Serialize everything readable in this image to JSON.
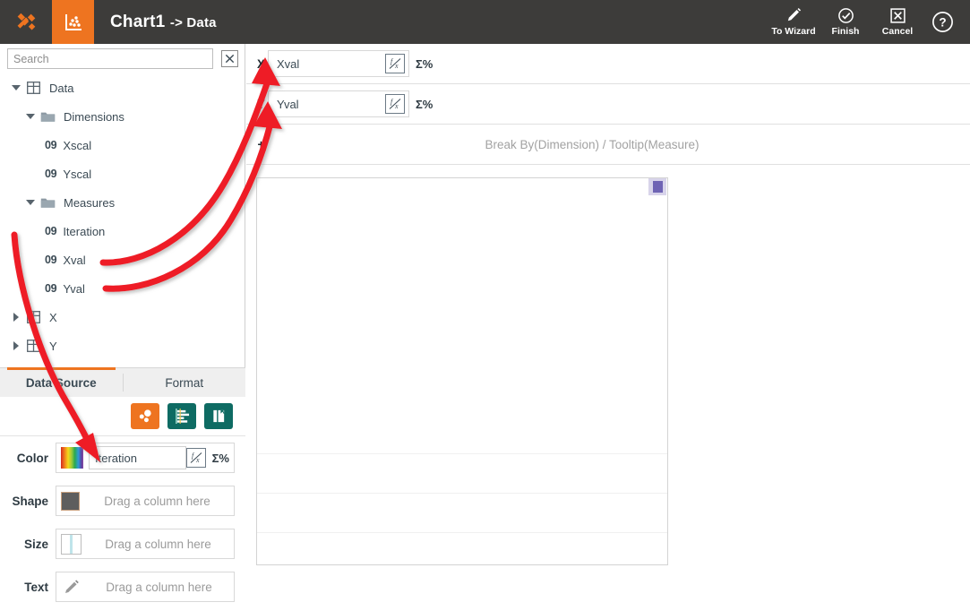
{
  "header": {
    "logo_icon": "crossed-tools-logo",
    "chart_type_icon": "scatter-plot-icon",
    "title": "Chart1",
    "title_suffix": "-> Data",
    "actions": [
      {
        "label": "To Wizard",
        "icon": "pencil-icon"
      },
      {
        "label": "Finish",
        "icon": "check-circle-icon"
      },
      {
        "label": "Cancel",
        "icon": "x-box-icon"
      }
    ],
    "help_icon": "question-circle-icon",
    "bg_color": "#3d3c3a",
    "accent_color": "#ee7420"
  },
  "left_panel": {
    "search": {
      "placeholder": "Search",
      "value": "",
      "clear_icon": "x-box-icon"
    },
    "tree": [
      {
        "label": "Data",
        "indent": 0,
        "caret": "down",
        "icon": "table-icon",
        "badge": ""
      },
      {
        "label": "Dimensions",
        "indent": 1,
        "caret": "down",
        "icon": "folder-icon",
        "badge": ""
      },
      {
        "label": "Xscal",
        "indent": 2,
        "caret": "none",
        "icon": "number-icon",
        "badge": "09"
      },
      {
        "label": "Yscal",
        "indent": 2,
        "caret": "none",
        "icon": "number-icon",
        "badge": "09"
      },
      {
        "label": "Measures",
        "indent": 1,
        "caret": "down",
        "icon": "folder-icon",
        "badge": ""
      },
      {
        "label": "Iteration",
        "indent": 2,
        "caret": "none",
        "icon": "number-icon",
        "badge": "09"
      },
      {
        "label": "Xval",
        "indent": 2,
        "caret": "none",
        "icon": "number-icon",
        "badge": "09"
      },
      {
        "label": "Yval",
        "indent": 2,
        "caret": "none",
        "icon": "number-icon",
        "badge": "09"
      },
      {
        "label": "X",
        "indent": 0,
        "caret": "right",
        "icon": "table-icon",
        "badge": ""
      },
      {
        "label": "Y",
        "indent": 0,
        "caret": "right",
        "icon": "table-icon",
        "badge": ""
      }
    ],
    "tabs": [
      {
        "label": "Data Source",
        "active": true
      },
      {
        "label": "Format",
        "active": false
      }
    ],
    "mark_types": [
      {
        "name": "bubble-chart-icon",
        "active": true,
        "color": "#ee7420"
      },
      {
        "name": "bar-chart-icon",
        "active": false,
        "color": "#0e6b63"
      },
      {
        "name": "page-flip-icon",
        "active": false,
        "color": "#0e6b63"
      }
    ],
    "mark_rows": [
      {
        "label": "Color",
        "swatch": "rainbow-gradient-swatch",
        "value": "Iteration",
        "has_field": true,
        "fx_icon": "fx-icon",
        "sigma": "Σ%"
      },
      {
        "label": "Shape",
        "swatch": "gray-square-swatch",
        "value": "Drag a column here",
        "has_field": false,
        "fx_icon": "",
        "sigma": ""
      },
      {
        "label": "Size",
        "swatch": "size-bar-swatch",
        "value": "Drag a column here",
        "has_field": false,
        "fx_icon": "",
        "sigma": ""
      },
      {
        "label": "Text",
        "swatch": "pencil-icon",
        "value": "Drag a column here",
        "has_field": false,
        "fx_icon": "",
        "sigma": ""
      }
    ]
  },
  "right_panel": {
    "shelves": [
      {
        "key": "X",
        "value": "Xval",
        "fx_icon": "fx-icon",
        "sigma": "Σ%",
        "placeholder": ""
      },
      {
        "key": "Y",
        "value": "Yval",
        "fx_icon": "fx-icon",
        "sigma": "Σ%",
        "placeholder": ""
      },
      {
        "key": "+",
        "value": "",
        "fx_icon": "",
        "sigma": "",
        "placeholder": "Break By(Dimension) / Tooltip(Measure)"
      }
    ],
    "canvas": {
      "marker_icon": "purple-square-marker",
      "marker_color": "#6f64b4"
    }
  },
  "annotations": {
    "arrow_color": "#ee1c25",
    "arrows": [
      {
        "name": "arrow-xval-to-x-shelf",
        "from": "Xval",
        "to": "X shelf"
      },
      {
        "name": "arrow-yval-to-y-shelf",
        "from": "Yval",
        "to": "Y shelf"
      },
      {
        "name": "arrow-iteration-to-color",
        "from": "Iteration",
        "to": "Color mark"
      }
    ]
  }
}
